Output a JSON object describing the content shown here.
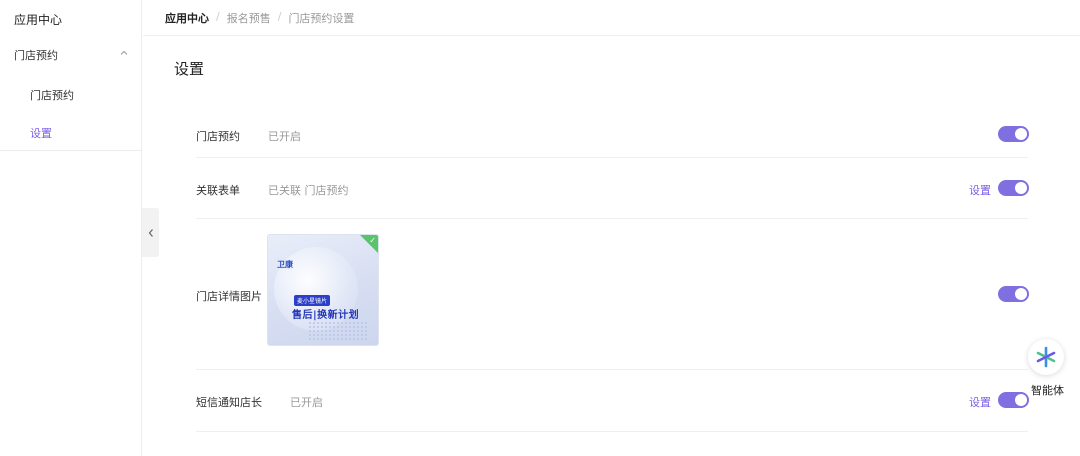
{
  "sidebar": {
    "title": "应用中心",
    "group": {
      "label": "门店预约",
      "icon": "chevron-up-icon"
    },
    "items": [
      {
        "label": "门店预约",
        "active": false
      },
      {
        "label": "设置",
        "active": true
      }
    ]
  },
  "breadcrumb": [
    "应用中心",
    "报名预售",
    "门店预约设置"
  ],
  "breadcrumb_separator": "/",
  "page": {
    "title": "设置",
    "rows": [
      {
        "label": "门店预约",
        "value": "已开启",
        "toggle_on": true,
        "has_setting": false
      },
      {
        "label": "关联表单",
        "value": "已关联 门店预约",
        "toggle_on": true,
        "has_setting": true,
        "setting_label": "设置"
      },
      {
        "label": "门店详情图片",
        "value": "",
        "toggle_on": true,
        "has_setting": false
      },
      {
        "label": "短信通知店长",
        "value": "已开启",
        "toggle_on": true,
        "has_setting": true,
        "setting_label": "设置"
      }
    ],
    "thumbnail": {
      "brand": "卫康",
      "tag": "麦小星镜片",
      "headline": "售后|换新计划",
      "selected": true
    }
  },
  "assistant": {
    "label": "智能体",
    "icon": "sparkle-icon"
  },
  "colors": {
    "accent": "#7b5ce6",
    "toggle": "#7f6fe0",
    "check": "#5ac36e"
  }
}
